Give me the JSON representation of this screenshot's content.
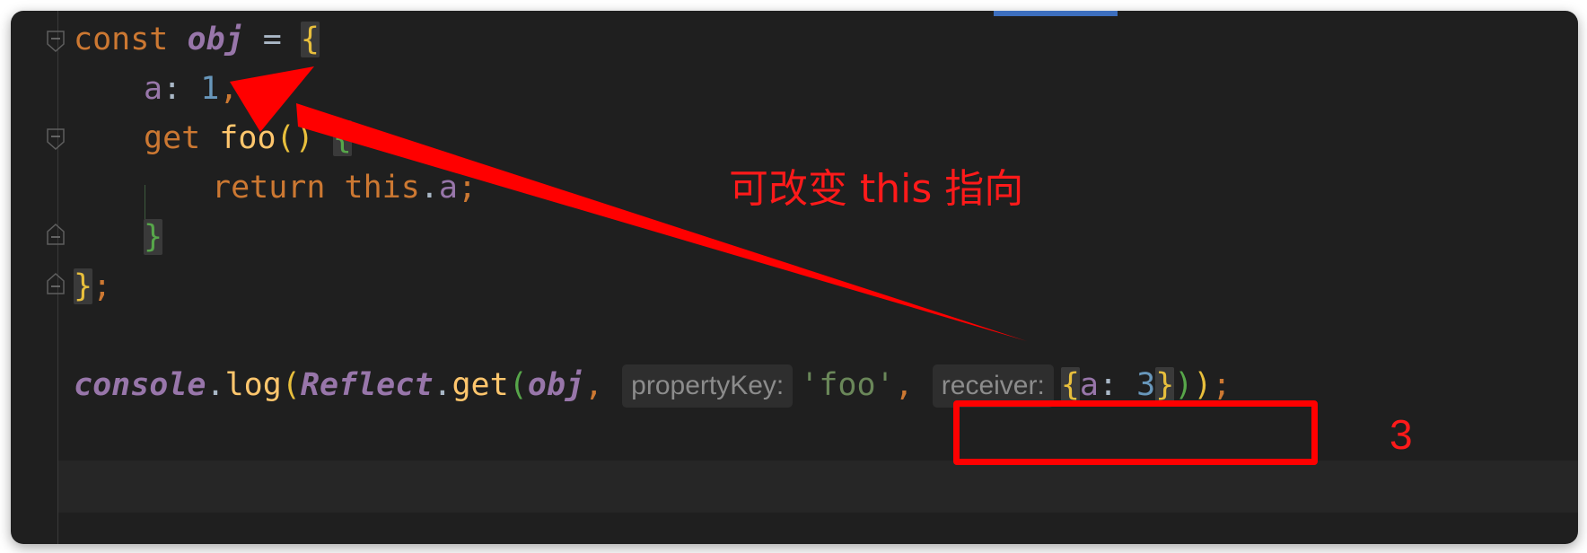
{
  "editor": {
    "language": "javascript",
    "lines": {
      "l1": {
        "kw": "const",
        "name": "obj",
        "eq": "=",
        "open": "{"
      },
      "l2": {
        "key": "a",
        "colon": ":",
        "value": "1",
        "comma": ","
      },
      "l3": {
        "kw": "get",
        "fn": "foo",
        "parens": "()",
        "open": "{"
      },
      "l4": {
        "kw": "return",
        "this": "this",
        "dot": ".",
        "prop": "a",
        "semi": ";"
      },
      "l5": {
        "close": "}"
      },
      "l6": {
        "close": "}",
        "semi": ";"
      },
      "l8": {
        "console": "console",
        "dot1": ".",
        "log": "log",
        "p1": "(",
        "reflect": "Reflect",
        "dot2": ".",
        "get": "get",
        "p2": "(",
        "obj": "obj",
        "c1": ",",
        "hint1": "propertyKey:",
        "str": "'foo'",
        "c2": ",",
        "hint2": "receiver:",
        "bo": "{",
        "key": "a",
        "colon": ":",
        "num": "3",
        "bc": "}",
        "p3": ")",
        "p4": ")",
        "semi": ";"
      }
    }
  },
  "annotations": {
    "label": "可改变 this 指向",
    "result": "3",
    "color": "#ff0000"
  }
}
